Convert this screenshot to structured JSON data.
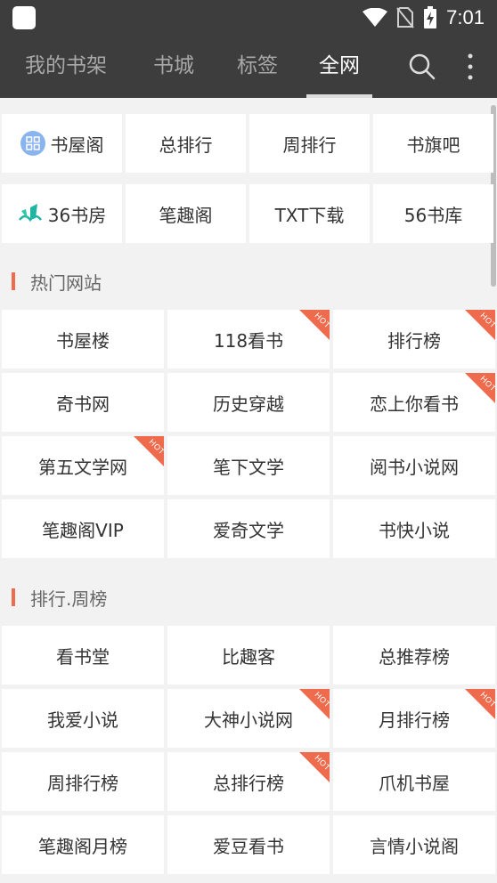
{
  "status_bar": {
    "time": "7:01"
  },
  "header": {
    "tabs": [
      {
        "label": "我的书架",
        "active": false
      },
      {
        "label": "书城",
        "active": false
      },
      {
        "label": "标签",
        "active": false
      },
      {
        "label": "全网",
        "active": true
      }
    ]
  },
  "quick_links": [
    {
      "label": "书屋阁",
      "icon": "grid-circle-icon"
    },
    {
      "label": "总排行"
    },
    {
      "label": "周排行"
    },
    {
      "label": "书旗吧"
    },
    {
      "label": "36书房",
      "icon": "book-feather-icon"
    },
    {
      "label": "笔趣阁"
    },
    {
      "label": "TXT下载"
    },
    {
      "label": "56书库"
    }
  ],
  "sections": [
    {
      "title": "热门网站",
      "items": [
        {
          "label": "书屋楼",
          "hot": false
        },
        {
          "label": "118看书",
          "hot": true
        },
        {
          "label": "排行榜",
          "hot": true
        },
        {
          "label": "奇书网",
          "hot": false
        },
        {
          "label": "历史穿越",
          "hot": false
        },
        {
          "label": "恋上你看书",
          "hot": true
        },
        {
          "label": "第五文学网",
          "hot": true
        },
        {
          "label": "笔下文学",
          "hot": false
        },
        {
          "label": "阅书小说网",
          "hot": false
        },
        {
          "label": "笔趣阁VIP",
          "hot": false
        },
        {
          "label": "爱奇文学",
          "hot": false
        },
        {
          "label": "书快小说",
          "hot": false
        }
      ]
    },
    {
      "title": "排行.周榜",
      "items": [
        {
          "label": "看书堂",
          "hot": false
        },
        {
          "label": "比趣客",
          "hot": false
        },
        {
          "label": "总推荐榜",
          "hot": false
        },
        {
          "label": "我爱小说",
          "hot": false
        },
        {
          "label": "大神小说网",
          "hot": true
        },
        {
          "label": "月排行榜",
          "hot": true
        },
        {
          "label": "周排行榜",
          "hot": false
        },
        {
          "label": "总排行榜",
          "hot": true
        },
        {
          "label": "爪机书屋",
          "hot": false
        },
        {
          "label": "笔趣阁月榜",
          "hot": false
        },
        {
          "label": "爱豆看书",
          "hot": false
        },
        {
          "label": "言情小说阁",
          "hot": false
        }
      ]
    }
  ],
  "badge": {
    "text": "HOT",
    "color": "#ee6b4d"
  },
  "colors": {
    "header_bg": "#3d3d3d",
    "accent": "#ee6b4d",
    "page_bg": "#f2f2f2"
  }
}
